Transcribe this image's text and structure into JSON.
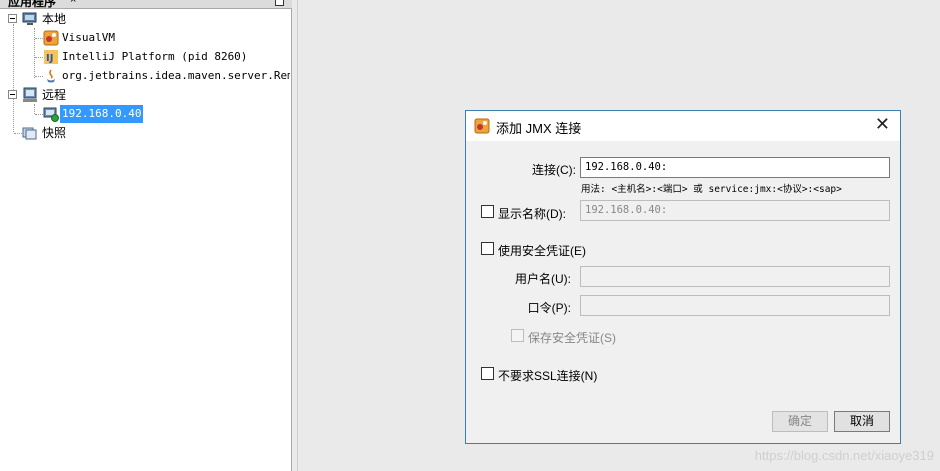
{
  "left_panel": {
    "tab_title": "应用程序",
    "tab_close": "×",
    "tree": {
      "local": "本地",
      "local_items": [
        "VisualVM",
        "IntelliJ Platform (pid 8260)",
        "org.jetbrains.idea.maven.server.Remote"
      ],
      "remote": "远程",
      "remote_items": [
        "192.168.0.40"
      ],
      "snapshots": "快照"
    }
  },
  "dialog": {
    "title": "添加 JMX 连接",
    "close": "✕",
    "connection_label": "连接(C):",
    "connection_value": "192.168.0.40:",
    "usage_text": "用法: <主机名>:<端口> 或 service:jmx:<协议>:<sap>",
    "display_name_label": "显示名称(D):",
    "display_name_value": "192.168.0.40:",
    "use_credentials_label": "使用安全凭证(E)",
    "username_label": "用户名(U):",
    "password_label": "口令(P):",
    "save_credentials_label": "保存安全凭证(S)",
    "no_ssl_label": "不要求SSL连接(N)",
    "ok_button": "确定",
    "cancel_button": "取消"
  },
  "watermark": "https://blog.csdn.net/xiaoye319"
}
